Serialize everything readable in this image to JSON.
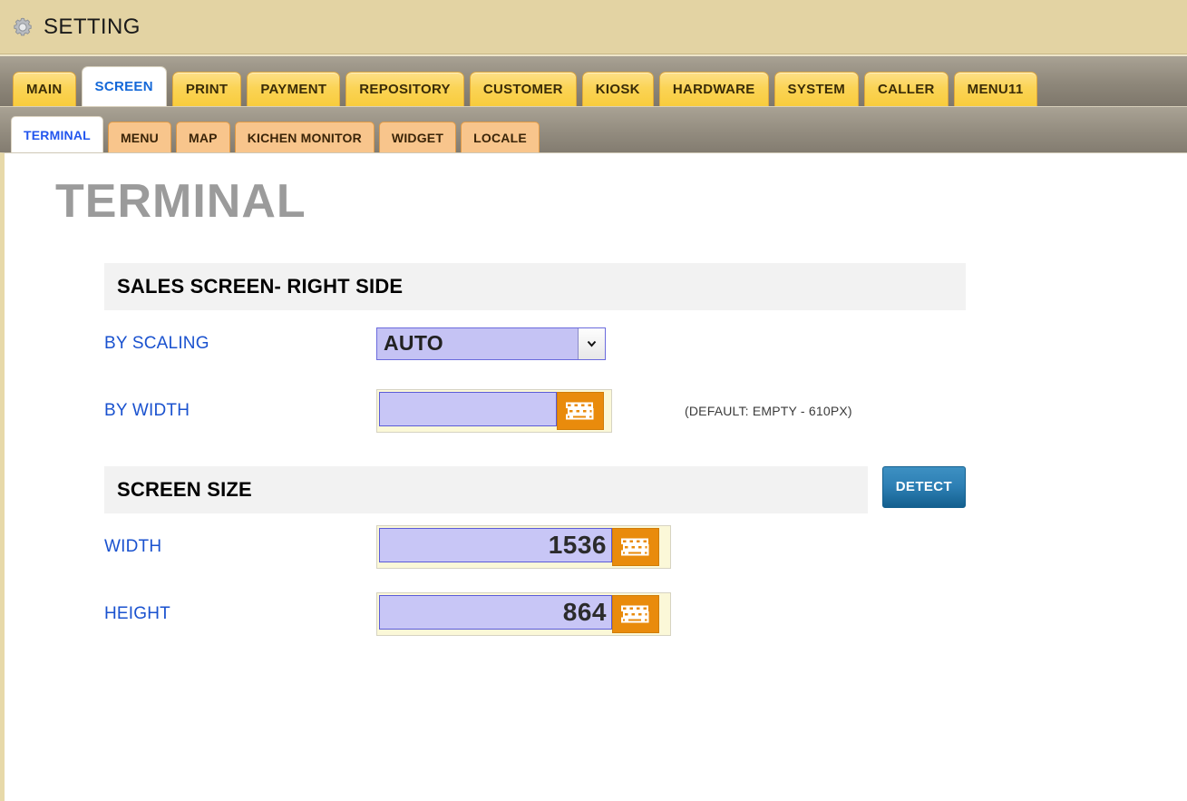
{
  "titlebar": {
    "icon": "gear-icon",
    "title": "SETTING"
  },
  "tabs": {
    "items": [
      {
        "label": "MAIN",
        "active": false
      },
      {
        "label": "SCREEN",
        "active": true
      },
      {
        "label": "PRINT",
        "active": false
      },
      {
        "label": "PAYMENT",
        "active": false
      },
      {
        "label": "REPOSITORY",
        "active": false
      },
      {
        "label": "CUSTOMER",
        "active": false
      },
      {
        "label": "KIOSK",
        "active": false
      },
      {
        "label": "HARDWARE",
        "active": false
      },
      {
        "label": "SYSTEM",
        "active": false
      },
      {
        "label": "CALLER",
        "active": false
      },
      {
        "label": "MENU11",
        "active": false
      }
    ]
  },
  "subtabs": {
    "items": [
      {
        "label": "TERMINAL",
        "active": true
      },
      {
        "label": "MENU",
        "active": false
      },
      {
        "label": "MAP",
        "active": false
      },
      {
        "label": "KICHEN MONITOR",
        "active": false
      },
      {
        "label": "WIDGET",
        "active": false
      },
      {
        "label": "LOCALE",
        "active": false
      }
    ]
  },
  "page": {
    "title": "TERMINAL"
  },
  "sales_screen": {
    "heading": "SALES SCREEN- RIGHT SIDE",
    "by_scaling": {
      "label": "BY SCALING",
      "value": "AUTO",
      "options": [
        "AUTO"
      ]
    },
    "by_width": {
      "label": "BY WIDTH",
      "value": "",
      "placeholder": "",
      "keyboard_icon": "keyboard-icon",
      "hint": "(DEFAULT: EMPTY - 610PX)"
    }
  },
  "screen_size": {
    "heading": "SCREEN SIZE",
    "detect_label": "DETECT",
    "width": {
      "label": "WIDTH",
      "value": "1536",
      "keyboard_icon": "keyboard-icon"
    },
    "height": {
      "label": "HEIGHT",
      "value": "864",
      "keyboard_icon": "keyboard-icon"
    }
  },
  "colors": {
    "titlebar_bg": "#e3d3a3",
    "tab_active_text": "#1468d8",
    "tab_bg": "#fbd456",
    "subtab_bg": "#f8c58c",
    "label_blue": "#1a52cf",
    "input_lavender": "#c8c6f6",
    "keyboard_orange": "#e98b0c",
    "detect_blue": "#2d7fb4",
    "section_gray": "#f2f2f2",
    "title_gray": "#9b9b9b"
  }
}
